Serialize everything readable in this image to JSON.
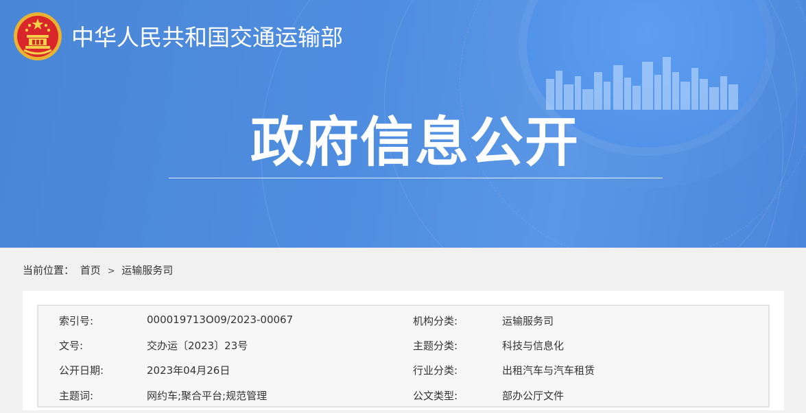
{
  "header": {
    "site_title": "中华人民共和国交通运输部",
    "page_title": "政府信息公开",
    "emblem_icon": "national-emblem-icon"
  },
  "breadcrumb": {
    "prefix": "当前位置：",
    "items": [
      "首页",
      "运输服务司"
    ],
    "separator": ">"
  },
  "meta": {
    "rows": [
      {
        "k1": "索引号:",
        "v1": "000019713O09/2023-00067",
        "k2": "机构分类:",
        "v2": "运输服务司"
      },
      {
        "k1": "文号:",
        "v1": "交办运〔2023〕23号",
        "k2": "主题分类:",
        "v2": "科技与信息化"
      },
      {
        "k1": "公开日期:",
        "v1": "2023年04月26日",
        "k2": "行业分类:",
        "v2": "出租汽车与汽车租赁"
      },
      {
        "k1": "主题词:",
        "v1": "网约车;聚合平台;规范管理",
        "k2": "公文类型:",
        "v2": "部办公厅文件"
      }
    ]
  },
  "colors": {
    "banner": "#4f8de0",
    "page_bg": "#f1f1f1",
    "table_bg": "#f7f7f7"
  }
}
